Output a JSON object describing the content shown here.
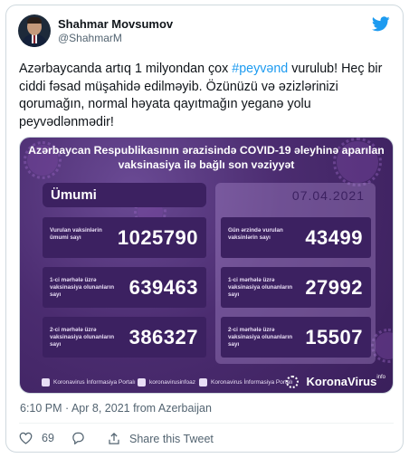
{
  "author": {
    "name": "Shahmar Movsumov",
    "handle": "@ShahmarM"
  },
  "tweet": {
    "text_before": "Azərbaycanda artıq 1 milyondan çox ",
    "hashtag": "#peyvənd",
    "text_after": " vurulub! Heç bir ciddi fəsad müşahidə edilməyib. Özünüzü və əzizlərinizi qorumağın, normal həyata qayıtmağın yeganə yolu peyvədlənmədir!"
  },
  "media": {
    "title_line1": "Azərbaycan Respublikasının ərazisində COVID-19 əleyhinə aparılan",
    "title_line2": "vaksinasiya ilə bağlı son vəziyyət",
    "left_header": "Ümumi",
    "right_header": "07.04.2021",
    "left_stats": [
      {
        "label": "Vurulan vaksinlərin ümumi sayı",
        "value": "1025790"
      },
      {
        "label": "1-ci mərhələ üzrə vaksinasiya olunanların sayı",
        "value": "639463"
      },
      {
        "label": "2-ci mərhələ üzrə vaksinasiya olunanların sayı",
        "value": "386327"
      }
    ],
    "right_stats": [
      {
        "label": "Gün ərzində vurulan vaksinlərin sayı",
        "value": "43499"
      },
      {
        "label": "1-ci mərhələ üzrə vaksinasiya olunanların sayı",
        "value": "27992"
      },
      {
        "label": "2-ci mərhələ üzrə vaksinasiya olunanların sayı",
        "value": "15507"
      }
    ],
    "footer_links": [
      "Koronavirus İnformasiya Portalı",
      "koronavirusinfoaz",
      "Koronavirus İnformasiya Portalı"
    ],
    "brand": "KoronaVirus",
    "brand_sup": "info"
  },
  "meta": {
    "timestamp": "6:10 PM · Apr 8, 2021 from Azerbaijan"
  },
  "actions": {
    "likes": "69",
    "share_label": "Share this Tweet"
  },
  "colors": {
    "link": "#1d9bf0",
    "twitter_blue": "#1d9bf0",
    "panel_dark": "#3c2161",
    "muted": "#536471"
  },
  "icons": [
    "twitter-bird-icon",
    "heart-icon",
    "reply-icon",
    "share-icon",
    "facebook-icon",
    "instagram-icon",
    "youtube-icon",
    "virus-icon"
  ]
}
